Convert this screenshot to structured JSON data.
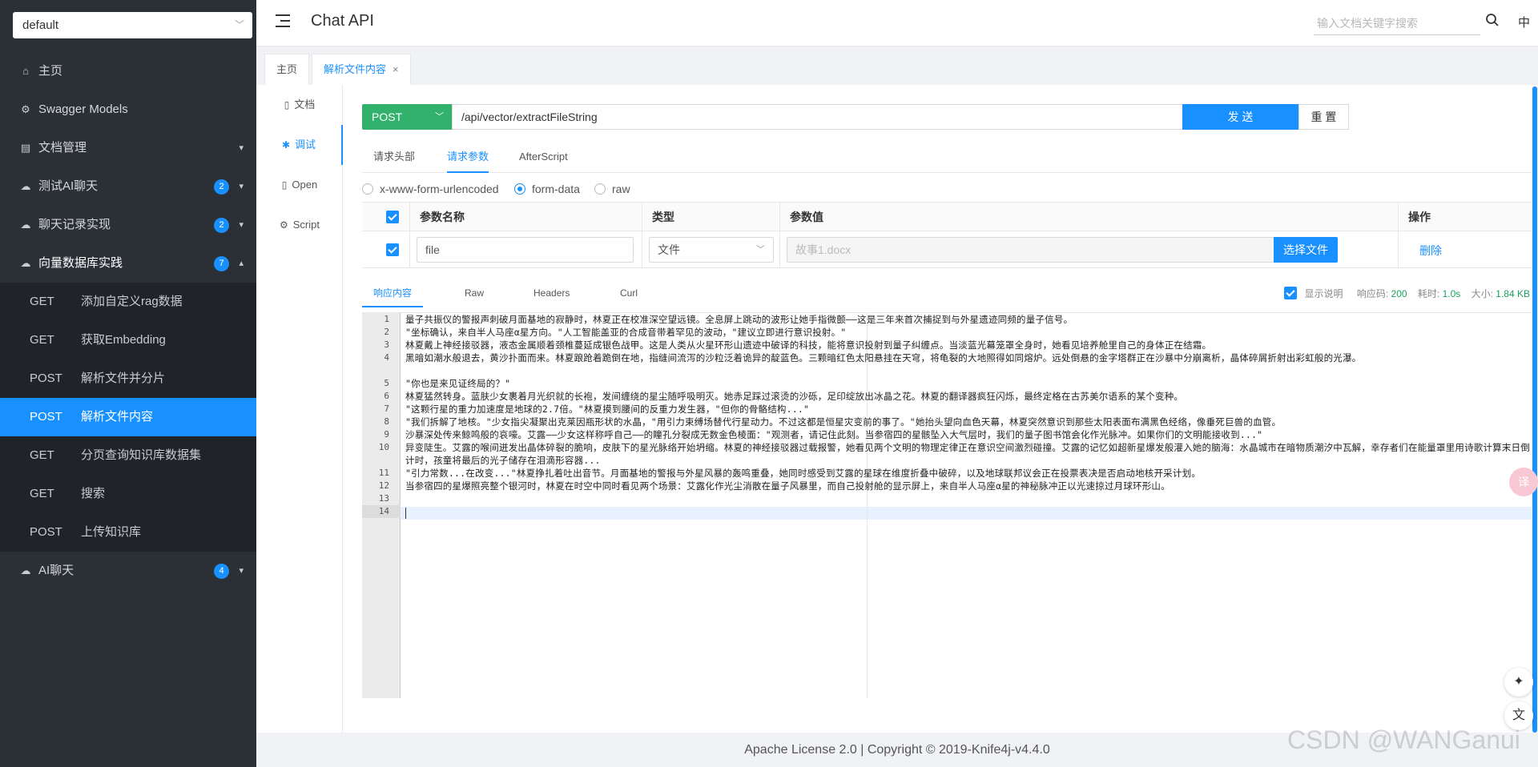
{
  "sidebar": {
    "group": "default",
    "items": [
      {
        "icon": "home-icon",
        "label": "主页"
      },
      {
        "icon": "swagger-icon",
        "label": "Swagger Models"
      },
      {
        "icon": "docs-icon",
        "label": "文档管理"
      },
      {
        "icon": "cloud-icon",
        "label": "测试AI聊天",
        "badge": "2"
      },
      {
        "icon": "cloud-icon",
        "label": "聊天记录实现",
        "badge": "2"
      },
      {
        "icon": "cloud-icon",
        "label": "向量数据库实践",
        "badge": "7"
      }
    ],
    "sub_items": [
      {
        "method": "GET",
        "label": "添加自定义rag数据"
      },
      {
        "method": "GET",
        "label": "获取Embedding"
      },
      {
        "method": "POST",
        "label": "解析文件并分片"
      },
      {
        "method": "POST",
        "label": "解析文件内容"
      },
      {
        "method": "GET",
        "label": "分页查询知识库数据集"
      },
      {
        "method": "GET",
        "label": "搜索"
      },
      {
        "method": "POST",
        "label": "上传知识库"
      }
    ],
    "last_item": {
      "icon": "cloud-icon",
      "label": "AI聊天",
      "badge": "4"
    }
  },
  "header": {
    "title": "Chat API",
    "search_placeholder": "输入文档关键字搜索",
    "lang": "中"
  },
  "page_tabs": [
    "主页",
    "解析文件内容"
  ],
  "side_tabs": [
    "文档",
    "调试",
    "Open",
    "Script"
  ],
  "request": {
    "method": "POST",
    "url": "/api/vector/extractFileString",
    "send": "发 送",
    "reset": "重 置"
  },
  "request_tabs": [
    "请求头部",
    "请求参数",
    "AfterScript"
  ],
  "body_types": [
    "x-www-form-urlencoded",
    "form-data",
    "raw"
  ],
  "param_table": {
    "headers": [
      "参数名称",
      "类型",
      "参数值",
      "操作"
    ],
    "row": {
      "name": "file",
      "type": "文件",
      "value_placeholder": "故事1.docx",
      "choose": "选择文件",
      "delete": "删除"
    }
  },
  "response": {
    "tabs": [
      "响应内容",
      "Raw",
      "Headers",
      "Curl"
    ],
    "show_desc": "显示说明",
    "code_label": "响应码:",
    "code": "200",
    "time_label": "耗时:",
    "time": "1.0s",
    "size_label": "大小:",
    "size": "1.84 KB",
    "line_numbers": [
      "1",
      "2",
      "3",
      "4",
      "5",
      "6",
      "7",
      "8",
      "9",
      "10",
      "11",
      "12",
      "13",
      "14"
    ],
    "lines": [
      "量子共振仪的警报声刺破月面基地的寂静时，林夏正在校准深空望远镜。全息屏上跳动的波形让她手指微颤——这是三年来首次捕捉到与外星遗迹同频的量子信号。",
      "\"坐标确认，来自半人马座α星方向。\"人工智能盖亚的合成音带着罕见的波动，\"建议立即进行意识投射。\"",
      "林夏戴上神经接驳器，液态金属顺着颈椎蔓延成银色战甲。这是人类从火星环形山遗迹中破译的科技，能将意识投射到量子纠缠点。当淡蓝光幕笼罩全身时，她看见培养舱里自己的身体正在结霜。",
      "黑暗如潮水般退去，黄沙扑面而来。林夏踉跄着跪倒在地，指缝间流泻的沙粒泛着诡异的靛蓝色。三颗暗红色太阳悬挂在天穹，将龟裂的大地照得如同熔炉。远处倒悬的金字塔群正在沙暴中分崩离析，晶体碎屑折射出彩虹般的光瀑。",
      "\"你也是来见证终局的？\"",
      "林夏猛然转身。蓝肤少女裹着月光织就的长袍，发间缠绕的星尘随呼吸明灭。她赤足踩过滚烫的沙砾，足印绽放出冰晶之花。林夏的翻译器疯狂闪烁，最终定格在古苏美尔语系的某个变种。",
      "\"这颗行星的重力加速度是地球的2.7倍。\"林夏摸到腰间的反重力发生器，\"但你的骨骼结构...\"",
      "\"我们拆解了地核。\"少女指尖凝聚出克莱因瓶形状的水晶，\"用引力束缚场替代行星动力。不过这都是恒星灾变前的事了。\"她抬头望向血色天幕，林夏突然意识到那些太阳表面布满黑色经络，像垂死巨兽的血管。",
      "沙暴深处传来鲸鸣般的哀嚎。艾露——少女这样称呼自己——的瞳孔分裂成无数金色棱面：\"观测者，请记住此刻。当参宿四的星骸坠入大气层时，我们的量子图书馆会化作光脉冲。如果你们的文明能接收到...\"",
      "异变陡生。艾露的喉间迸发出晶体碎裂的脆响，皮肤下的星光脉络开始坍缩。林夏的神经接驳器过载报警，她看见两个文明的物理定律正在意识空间激烈碰撞。艾露的记忆如超新星爆发般灌入她的脑海：水晶城市在暗物质潮汐中瓦解，幸存者们在能量罩里用诗歌计算末日倒计时，孩童将最后的光子储存在泪滴形容器...",
      "\"引力常数...在改变...\"林夏挣扎着吐出音节。月面基地的警报与外星风暴的轰鸣重叠，她同时感受到艾露的星球在维度折叠中破碎，以及地球联邦议会正在投票表决是否启动地核开采计划。",
      "当参宿四的星爆照亮整个银河时，林夏在时空中同时看见两个场景：艾露化作光尘消散在量子风暴里，而自己投射舱的显示屏上，来自半人马座α星的神秘脉冲正以光速掠过月球环形山。",
      "",
      ""
    ]
  },
  "footer": "Apache License 2.0 | Copyright © 2019-Knife4j-v4.4.0",
  "watermark": "CSDN @WANGanui",
  "colors": {
    "accent": "#1890ff",
    "post": "#32b16c",
    "sidebar": "#2b3037"
  }
}
